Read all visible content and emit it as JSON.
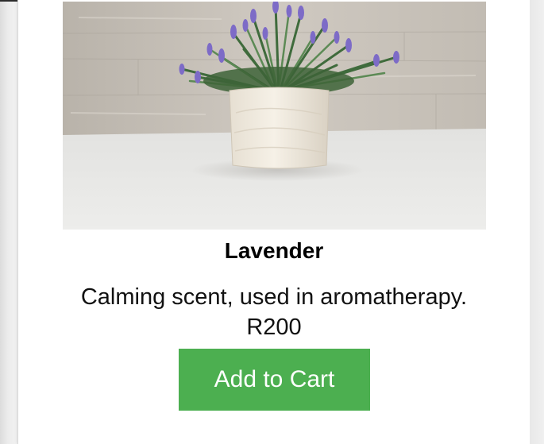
{
  "product": {
    "name": "Lavender",
    "description": "Calming scent, used in aromatherapy.",
    "price": "R200",
    "add_to_cart_label": "Add to Cart",
    "image_icon": "lavender-plant-in-white-pot"
  },
  "colors": {
    "button": "#4caf50",
    "button_text": "#ffffff",
    "card_background": "#ffffff",
    "page_background": "#ececec"
  }
}
